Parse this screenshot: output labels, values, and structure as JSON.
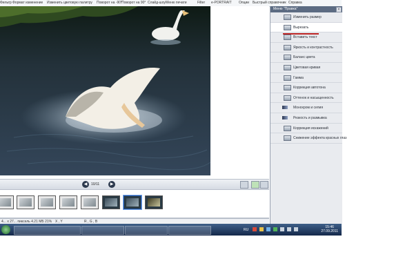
{
  "toolbar": {
    "items": [
      "Фильтр",
      "Формат изменение",
      "Изменить цветовую палитру",
      "Поворот на -90°",
      "Поворот на 90°",
      "Слайд-шоу",
      "Меню печати",
      "Filter",
      "e-PORTRAIT",
      "Опции",
      "Быстрый справочник",
      "Справка"
    ]
  },
  "panel": {
    "title": "Меню \"Правка\"",
    "items": [
      "Изменить размер",
      "Вырезать",
      "Вставить текст",
      "Яркость и контрастность",
      "Баланс цвета",
      "Цветовая кривая",
      "Гамма",
      "Коррекция автотона",
      "Оттенок и насыщенность",
      "Монохром и сепия",
      "Резкость и размывка",
      "Коррекция искажений",
      "Снижение эффекта красных глаз"
    ],
    "active_index": 1
  },
  "navigation": {
    "counter": "10/11"
  },
  "filmstrip": {
    "thumb_count": 8,
    "selected_index": 6
  },
  "status": {
    "file_info": "4... x 27... пиксель  4.21 МБ  21%",
    "xy": "X ,  Y",
    "rgb": "R ,  G ,  B"
  },
  "taskbar": {
    "language": "RU",
    "time": "15:46",
    "date": "27.09.2011"
  },
  "colors": {
    "panel_header": "#5c6b82",
    "active_underline": "#b22222",
    "taskbar": "#1d3557"
  }
}
